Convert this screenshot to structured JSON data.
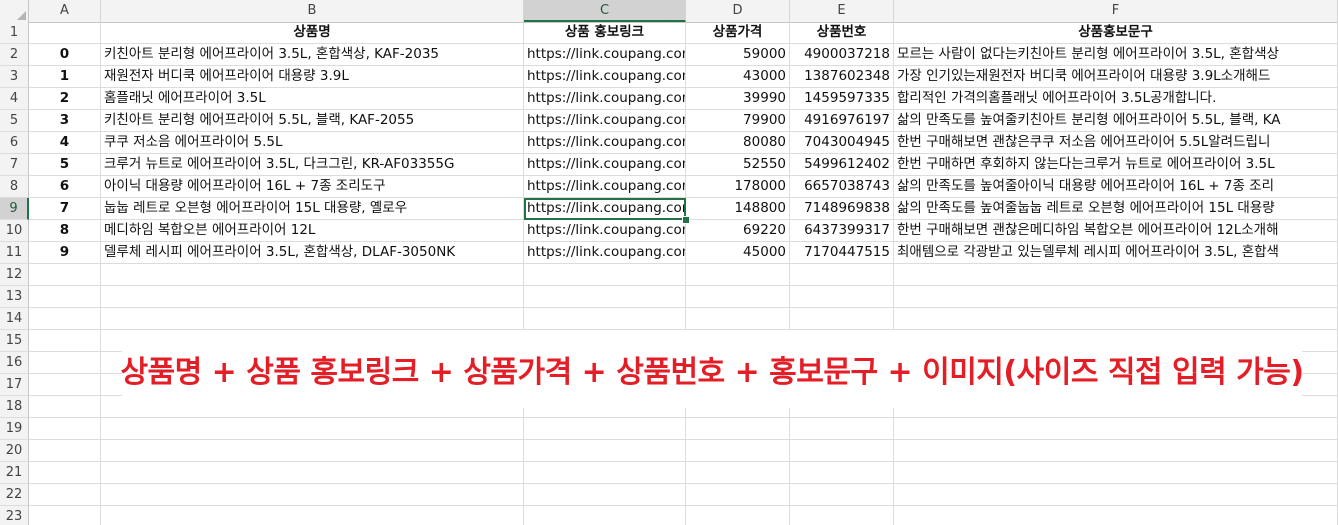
{
  "columns": [
    "A",
    "B",
    "C",
    "D",
    "E",
    "F"
  ],
  "selected_column": "C",
  "header_row": {
    "row_num": "1",
    "cells": [
      "",
      "상품명",
      "상품 홍보링크",
      "상품가격",
      "상품번호",
      "상품홍보문구"
    ]
  },
  "rows": [
    {
      "row_num": "2",
      "a": "0",
      "b": "키친아트 분리형 에어프라이어 3.5L, 혼합색상, KAF-2035",
      "c": "https://link.coupang.com",
      "d": "59000",
      "e": "4900037218",
      "f": "모르는 사람이 없다는키친아트 분리형 에어프라이어 3.5L, 혼합색상"
    },
    {
      "row_num": "3",
      "a": "1",
      "b": "재원전자 버디쿡 에어프라이어 대용량 3.9L",
      "c": "https://link.coupang.com",
      "d": "43000",
      "e": "1387602348",
      "f": "가장 인기있는재원전자 버디쿡 에어프라이어 대용량 3.9L소개해드"
    },
    {
      "row_num": "4",
      "a": "2",
      "b": "홈플래닛 에어프라이어 3.5L",
      "c": "https://link.coupang.com",
      "d": "39990",
      "e": "1459597335",
      "f": "합리적인 가격의홈플래닛 에어프라이어 3.5L공개합니다."
    },
    {
      "row_num": "5",
      "a": "3",
      "b": "키친아트 분리형 에어프라이어 5.5L, 블랙, KAF-2055",
      "c": "https://link.coupang.com",
      "d": "79900",
      "e": "4916976197",
      "f": "삶의 만족도를 높여줄키친아트 분리형 에어프라이어 5.5L, 블랙, KA"
    },
    {
      "row_num": "6",
      "a": "4",
      "b": "쿠쿠 저소음 에어프라이어 5.5L",
      "c": "https://link.coupang.com",
      "d": "80080",
      "e": "7043004945",
      "f": "한번 구매해보면 괜찮은쿠쿠 저소음 에어프라이어 5.5L알려드립니"
    },
    {
      "row_num": "7",
      "a": "5",
      "b": "크루거 뉴트로 에어프라이어 3.5L, 다크그린, KR-AF03355G",
      "c": "https://link.coupang.com",
      "d": "52550",
      "e": "5499612402",
      "f": "한번 구매하면 후회하지 않는다는크루거 뉴트로 에어프라이어 3.5L"
    },
    {
      "row_num": "8",
      "a": "6",
      "b": "아이닉 대용량 에어프라이어 16L + 7종 조리도구",
      "c": "https://link.coupang.com",
      "d": "178000",
      "e": "6657038743",
      "f": "삶의 만족도를 높여줄아이닉 대용량 에어프라이어 16L + 7종 조리"
    },
    {
      "row_num": "9",
      "a": "7",
      "b": "눕눕 레트로 오븐형 에어프라이어 15L 대용량, 옐로우",
      "c": "https://link.coupang.com",
      "d": "148800",
      "e": "7148969838",
      "f": "삶의 만족도를 높여줄눕눕 레트로 오븐형 에어프라이어 15L 대용량"
    },
    {
      "row_num": "10",
      "a": "8",
      "b": "메디하임 복합오븐 에어프라이어 12L",
      "c": "https://link.coupang.com",
      "d": "69220",
      "e": "6437399317",
      "f": "한번 구매해보면 괜찮은메디하임 복합오븐 에어프라이어 12L소개해"
    },
    {
      "row_num": "11",
      "a": "9",
      "b": "델루체 레시피 에어프라이어 3.5L, 혼합색상, DLAF-3050NK",
      "c": "https://link.coupang.com",
      "d": "45000",
      "e": "7170447515",
      "f": "최애템으로 각광받고 있는델루체 레시피 에어프라이어 3.5L, 혼합색"
    }
  ],
  "empty_rows": [
    "12",
    "13",
    "14",
    "15",
    "16",
    "17",
    "18",
    "19",
    "20",
    "21",
    "22",
    "23"
  ],
  "banner": "상품명 + 상품 홍보링크 + 상품가격 + 상품번호 + 홍보문구 + 이미지(사이즈 직접 입력 가능)",
  "colors": {
    "accent": "#217346",
    "banner": "#e41e26",
    "header_bg": "#f3f3f3",
    "selected_header_bg": "#d2d2d2"
  }
}
